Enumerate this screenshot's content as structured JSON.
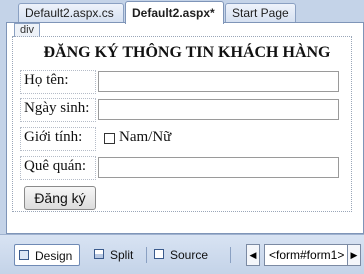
{
  "tabs": [
    {
      "label": "Default2.aspx.cs",
      "active": false
    },
    {
      "label": "Default2.aspx*",
      "active": true
    },
    {
      "label": "Start Page",
      "active": false
    }
  ],
  "designer": {
    "element_tag": "div"
  },
  "form": {
    "title": "ĐĂNG KÝ THÔNG TIN KHÁCH HÀNG",
    "rows": [
      {
        "label": "Họ tên:",
        "value": ""
      },
      {
        "label": "Ngày sinh:",
        "value": ""
      },
      {
        "label": "Giới tính:",
        "checkbox_label": "Nam/Nữ",
        "checked": false
      },
      {
        "label": "Quê quán:",
        "value": ""
      }
    ],
    "submit_label": "Đăng ký"
  },
  "bottom_bar": {
    "views": [
      {
        "label": "Design",
        "active": true,
        "icon": "design-view-icon"
      },
      {
        "label": "Split",
        "active": false,
        "icon": "split-view-icon"
      },
      {
        "label": "Source",
        "active": false,
        "icon": "source-view-icon"
      }
    ],
    "breadcrumb": "<form#form1>"
  },
  "colors": {
    "chrome_bg": "#c4d3e8",
    "tab_border": "#8aa0c2",
    "active_outline": "#6f8ab5"
  }
}
